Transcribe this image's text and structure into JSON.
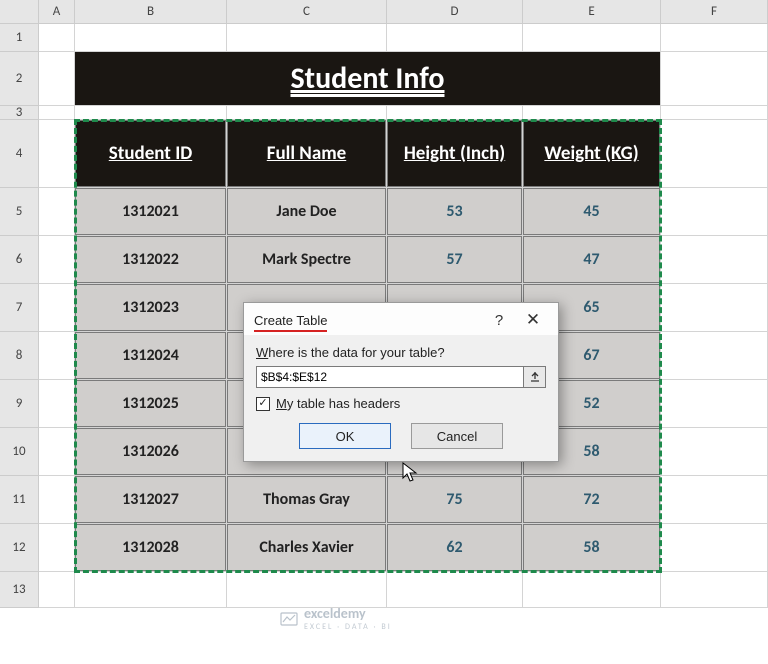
{
  "columns": [
    "A",
    "B",
    "C",
    "D",
    "E",
    "F"
  ],
  "rows": [
    "1",
    "2",
    "3",
    "4",
    "5",
    "6",
    "7",
    "8",
    "9",
    "10",
    "11",
    "12",
    "13"
  ],
  "title": "Student Info",
  "headers": {
    "id": "Student ID",
    "name": "Full Name",
    "height": "Height (Inch)",
    "weight": "Weight (KG)"
  },
  "data": [
    {
      "id": "1312021",
      "name": "Jane Doe",
      "h": "53",
      "w": "45"
    },
    {
      "id": "1312022",
      "name": "Mark Spectre",
      "h": "57",
      "w": "47"
    },
    {
      "id": "1312023",
      "name": "",
      "h": "",
      "w": "65"
    },
    {
      "id": "1312024",
      "name": "",
      "h": "",
      "w": "67"
    },
    {
      "id": "1312025",
      "name": "",
      "h": "",
      "w": "52"
    },
    {
      "id": "1312026",
      "name": "",
      "h": "",
      "w": "58"
    },
    {
      "id": "1312027",
      "name": "Thomas Gray",
      "h": "75",
      "w": "72"
    },
    {
      "id": "1312028",
      "name": "Charles Xavier",
      "h": "62",
      "w": "58"
    }
  ],
  "dialog": {
    "title": "Create Table",
    "question_pre": "W",
    "question_rest": "here is the data for your table?",
    "range": "$B$4:$E$12",
    "check_pre": "M",
    "check_rest": "y table has headers",
    "checked": true,
    "ok": "OK",
    "cancel": "Cancel"
  },
  "watermark": {
    "brand": "exceldemy",
    "sub": "EXCEL · DATA · BI"
  },
  "chart_data": {
    "type": "table",
    "title": "Student Info",
    "columns": [
      "Student ID",
      "Full Name",
      "Height (Inch)",
      "Weight (KG)"
    ],
    "rows": [
      [
        "1312021",
        "Jane Doe",
        53,
        45
      ],
      [
        "1312022",
        "Mark Spectre",
        57,
        47
      ],
      [
        "1312023",
        null,
        null,
        65
      ],
      [
        "1312024",
        null,
        null,
        67
      ],
      [
        "1312025",
        null,
        null,
        52
      ],
      [
        "1312026",
        null,
        null,
        58
      ],
      [
        "1312027",
        "Thomas Gray",
        75,
        72
      ],
      [
        "1312028",
        "Charles Xavier",
        62,
        58
      ]
    ],
    "selection": "$B$4:$E$12"
  }
}
